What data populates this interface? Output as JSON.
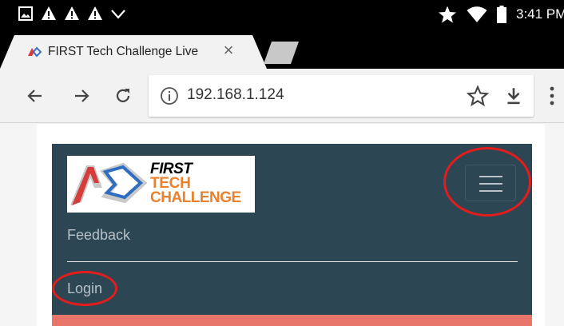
{
  "status_bar": {
    "time": "3:41 PM",
    "left_icons": [
      "image-icon",
      "warning-icon",
      "warning-icon",
      "warning-icon",
      "check-icon"
    ],
    "right_icons": [
      "star-icon",
      "wifi-icon",
      "battery-icon"
    ]
  },
  "tab": {
    "title": "FIRST Tech Challenge Live",
    "close_symbol": "×"
  },
  "toolbar": {
    "url": "192.168.1.124",
    "icons": [
      "back-arrow-icon",
      "forward-arrow-icon",
      "reload-icon",
      "info-icon",
      "bookmark-star-icon",
      "download-icon",
      "more-menu-icon"
    ]
  },
  "site": {
    "logo": {
      "line1": "FIRST",
      "line2": "TECH",
      "line3": "CHALLENGE"
    },
    "nav_items": [
      {
        "label": "Feedback"
      },
      {
        "label": "Login"
      }
    ]
  },
  "colors": {
    "navbar": "#2d4654",
    "accent_orange": "#e7822e",
    "annotation_red": "#e21d1d",
    "bottom_bar": "#e8756a"
  }
}
